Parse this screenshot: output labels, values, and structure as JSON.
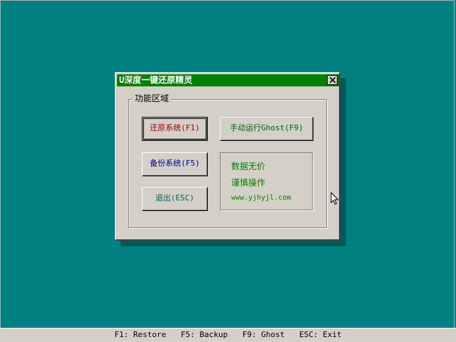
{
  "dialog": {
    "title": "U深度一键还原精灵",
    "group_label": "功能区域",
    "buttons": {
      "restore": "还原系统(F1)",
      "ghost": "手动运行Ghost(F9)",
      "backup": "备份系统(F5)",
      "exit": "退出(ESC)"
    },
    "info": {
      "line1": "数据无价",
      "line2": "谨慎操作",
      "url": "www.yjhyjl.com"
    }
  },
  "statusbar": {
    "items": [
      "F1: Restore",
      "F5: Backup",
      "F9: Ghost",
      "ESC: Exit"
    ]
  },
  "colors": {
    "desktop": "#008080",
    "titlebar": "#008000",
    "dialog_bg": "#d4d0c8",
    "restore_text": "#a00000",
    "ghost_text": "#006000",
    "backup_text": "#000080",
    "info_text": "#008000"
  },
  "icons": [
    "close-icon",
    "mouse-cursor-icon"
  ]
}
